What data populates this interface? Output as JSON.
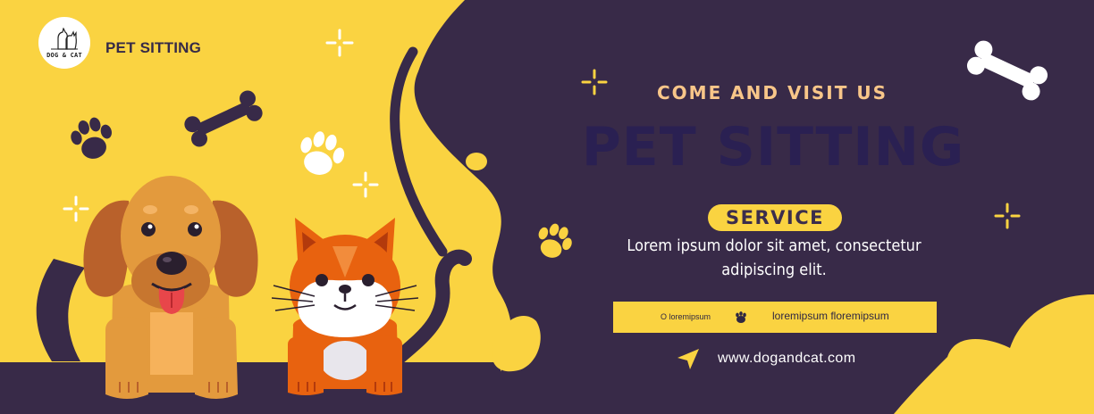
{
  "logo": {
    "text": "DOG & CAT",
    "icon": "dog-and-cat-silhouette-icon"
  },
  "brand": {
    "title": "PET SITTING"
  },
  "hero": {
    "kicker": "COME AND VISIT US",
    "headline": "PET SITTING",
    "service_label": "SERVICE",
    "tagline_line1": "Lorem ipsum dolor sit amet, consectetur",
    "tagline_line2": "adipiscing elit."
  },
  "info_bar": {
    "left_text": "O loremipsum",
    "right_text": "loremipsum floremipsum",
    "icon": "paw-icon"
  },
  "contact": {
    "website": "www.dogandcat.com",
    "icon": "navigation-arrow-icon"
  },
  "colors": {
    "yellow": "#fad341",
    "dark_purple": "#382a48",
    "kicker_peach": "#f8c689",
    "headline_navy": "#2a2052",
    "white": "#ffffff"
  }
}
